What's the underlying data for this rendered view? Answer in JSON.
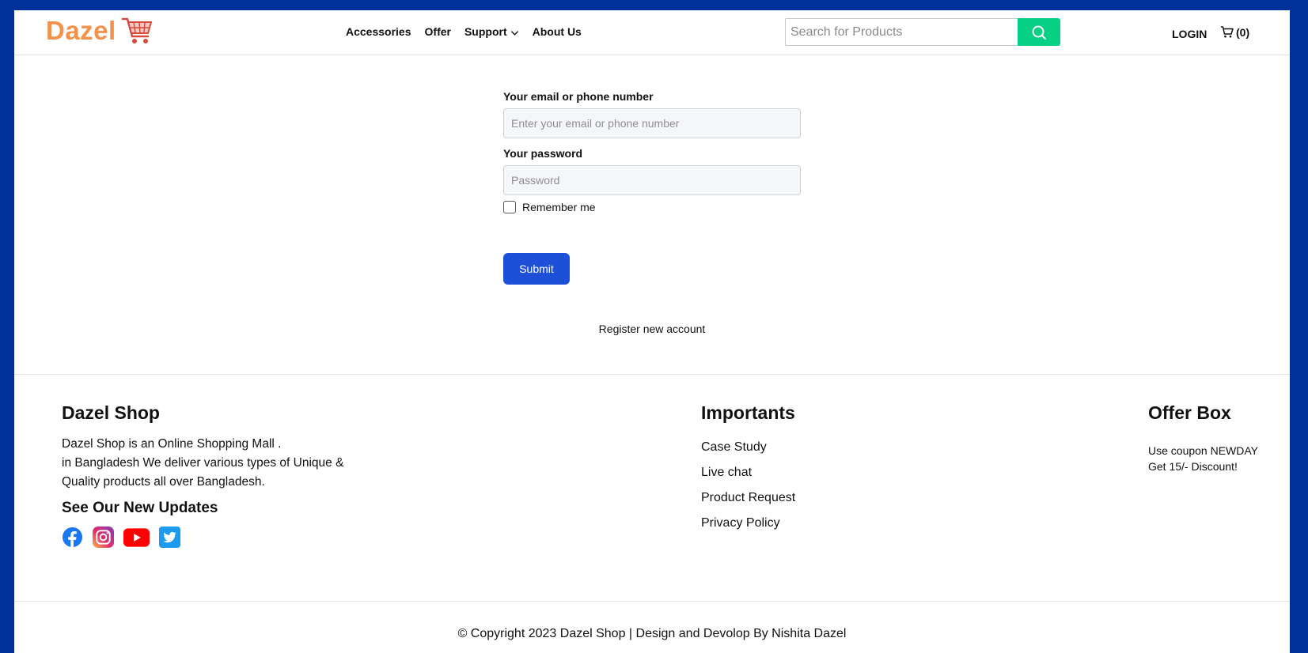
{
  "header": {
    "logo_text": "Dazel",
    "nav": [
      "Accessories",
      "Offer",
      "Support",
      "About Us"
    ],
    "search_placeholder": "Search for Products",
    "login_label": "LOGIN",
    "cart_count": "(0)"
  },
  "form": {
    "email_label": "Your email or phone number",
    "email_placeholder": "Enter your email or phone number",
    "password_label": "Your password",
    "password_placeholder": "Password",
    "remember_label": "Remember me",
    "submit_label": "Submit",
    "register_link": "Register new account"
  },
  "footer": {
    "shop": {
      "title": "Dazel Shop",
      "desc_lines": [
        "Dazel Shop is an Online Shopping Mall .",
        "in Bangladesh We deliver various types of Unique &",
        "Quality products all over Bangladesh."
      ],
      "updates_title": "See Our New Updates"
    },
    "importants": {
      "title": "Importants",
      "links": [
        "Case Study",
        "Live chat",
        "Product Request",
        "Privacy Policy"
      ]
    },
    "offer": {
      "title": "Offer Box",
      "lines": [
        "Use coupon NEWDAY",
        "Get 15/- Discount!"
      ]
    },
    "copyright": "© Copyright 2023 Dazel Shop | Design and Devolop By Nishita Dazel"
  },
  "colors": {
    "frame": "#00309a",
    "logo": "#f4914a",
    "search_button": "#05d083",
    "submit_button": "#1d4fd8"
  },
  "icons": [
    "shopping-cart-logo-icon",
    "chevron-down-icon",
    "search-icon",
    "cart-icon",
    "facebook-icon",
    "instagram-icon",
    "youtube-icon",
    "twitter-icon"
  ]
}
